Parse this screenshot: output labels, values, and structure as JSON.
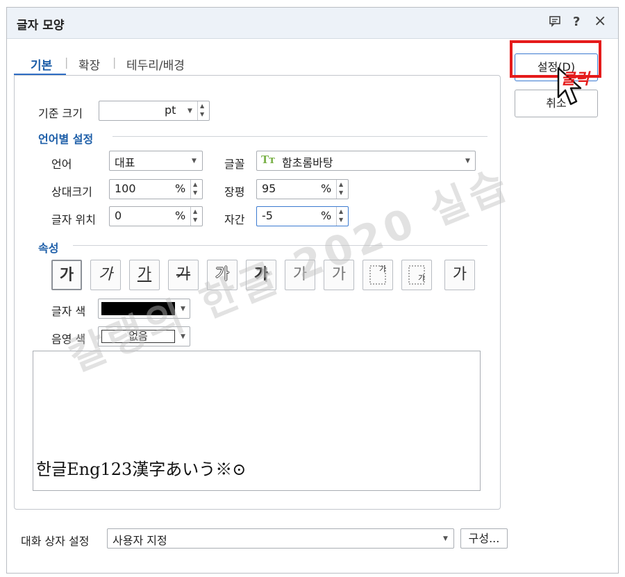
{
  "window": {
    "title": "글자 모양",
    "icons": [
      "comment-icon",
      "help-icon",
      "close-icon"
    ],
    "help_glyph": "?",
    "close_glyph": "×"
  },
  "tabs": [
    {
      "label": "기본",
      "active": true
    },
    {
      "label": "확장",
      "active": false
    },
    {
      "label": "테두리/배경",
      "active": false
    }
  ],
  "tab_separator": "|",
  "base_size": {
    "label": "기준 크기",
    "value": "",
    "unit": "pt"
  },
  "language": {
    "section": "언어별 설정",
    "lang_label": "언어",
    "lang_value": "대표",
    "font_label": "글꼴",
    "font_value": "함초롬바탕",
    "font_icon_glyph": "Tт",
    "rel_size_label": "상대크기",
    "rel_size_value": "100",
    "ratio_label": "장평",
    "ratio_value": "95",
    "pos_label": "글자 위치",
    "pos_value": "0",
    "spacing_label": "자간",
    "spacing_value": "-5",
    "percent": "%"
  },
  "attributes": {
    "section": "속성",
    "buttons": [
      {
        "name": "bold",
        "glyph": "가"
      },
      {
        "name": "italic",
        "glyph": "가"
      },
      {
        "name": "underline",
        "glyph": "가"
      },
      {
        "name": "strikethrough",
        "glyph": "가"
      },
      {
        "name": "outline",
        "glyph": "가"
      },
      {
        "name": "shadow",
        "glyph": "가"
      },
      {
        "name": "emboss",
        "glyph": "가"
      },
      {
        "name": "engrave",
        "glyph": "가"
      },
      {
        "name": "superscript",
        "glyph": "가"
      },
      {
        "name": "subscript",
        "glyph": "가"
      },
      {
        "name": "normal",
        "glyph": "가"
      }
    ]
  },
  "colors": {
    "text_color_label": "글자 색",
    "text_color": "#000000",
    "shade_color_label": "음영 색",
    "shade_value": "없음"
  },
  "preview_text": "한글Eng123漢字あいう※⊙",
  "footer": {
    "label": "대화 상자 설정",
    "value": "사용자 지정",
    "config_button": "구성..."
  },
  "side_buttons": {
    "set": "설정(D)",
    "cancel": "취소"
  },
  "annotation": {
    "click_text": "클릭",
    "color": "#e51b1b"
  },
  "watermark": "칼랭의 한글 2020 실습",
  "accent": "#1d5ea8"
}
